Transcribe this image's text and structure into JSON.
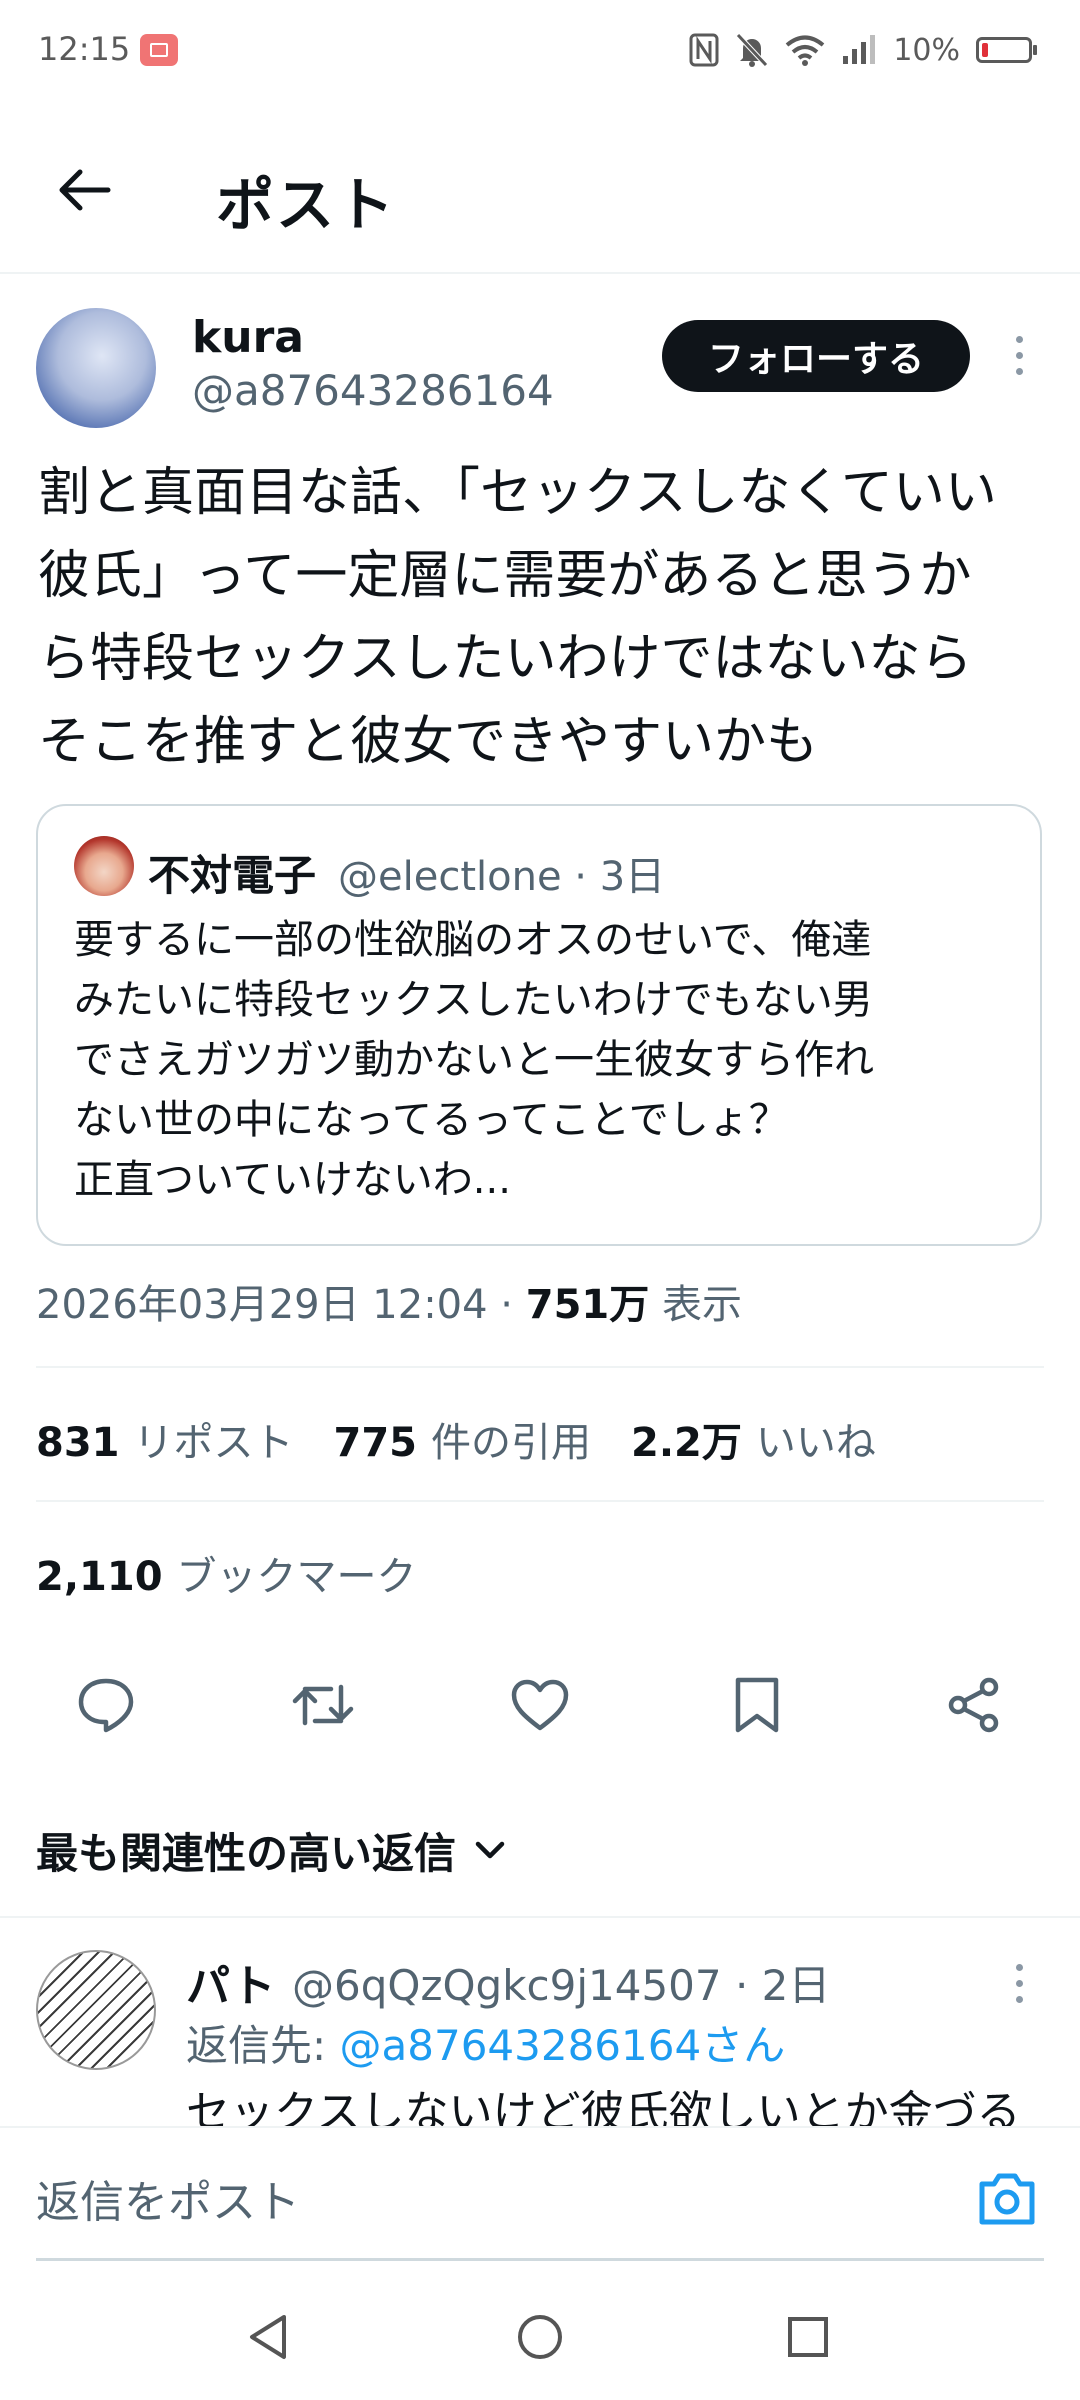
{
  "status_bar": {
    "time": "12:15",
    "battery_percent": "10%",
    "icons": [
      "battery-saver-icon",
      "nfc-icon",
      "mute-icon",
      "wifi-icon",
      "signal-icon",
      "battery-icon"
    ]
  },
  "header": {
    "title": "ポスト"
  },
  "post": {
    "author": {
      "name": "kura",
      "handle": "@a87643286164"
    },
    "follow_label": "フォローする",
    "body": "割と真面目な話、「セックスしなくていい\n彼氏」って一定層に需要があると思うか\nら特段セックスしたいわけではないなら\nそこを推すと彼女できやすいかも",
    "quote": {
      "name": "不対電子",
      "meta": "@electlone · 3日",
      "text": "要するに一部の性欲脳のオスのせいで、俺達\nみたいに特段セックスしたいわけでもない男\nでさえガツガツ動かないと一生彼女すら作れ\nない世の中になってるってことでしょ？\n正直ついていけないわ..."
    },
    "timestamp": "2026年03月29日 12:04 · ",
    "views_count": "751万",
    "views_label": " 表示",
    "stats": [
      {
        "count": "831",
        "label": "リポスト"
      },
      {
        "count": "775",
        "label": "件の引用"
      },
      {
        "count": "2.2万",
        "label": "いいね"
      }
    ],
    "bookmarks": {
      "count": "2,110",
      "label": "ブックマーク"
    }
  },
  "actions": [
    "reply-icon",
    "repost-icon",
    "like-icon",
    "bookmark-icon",
    "share-icon"
  ],
  "replies_sort_label": "最も関連性の高い返信",
  "reply": {
    "name": "パト",
    "meta": "@6qQzQgkc9j14507 · 2日",
    "reply_to_prefix": "返信先: ",
    "reply_to_handle": "@a87643286164さん",
    "text": "セックスしないけど彼氏欲しいとか金づる"
  },
  "composer": {
    "placeholder": "返信をポスト"
  },
  "colors": {
    "accent": "#1d9bf0",
    "text": "#0f1419",
    "secondary": "#536471",
    "border": "#cfd9de"
  }
}
